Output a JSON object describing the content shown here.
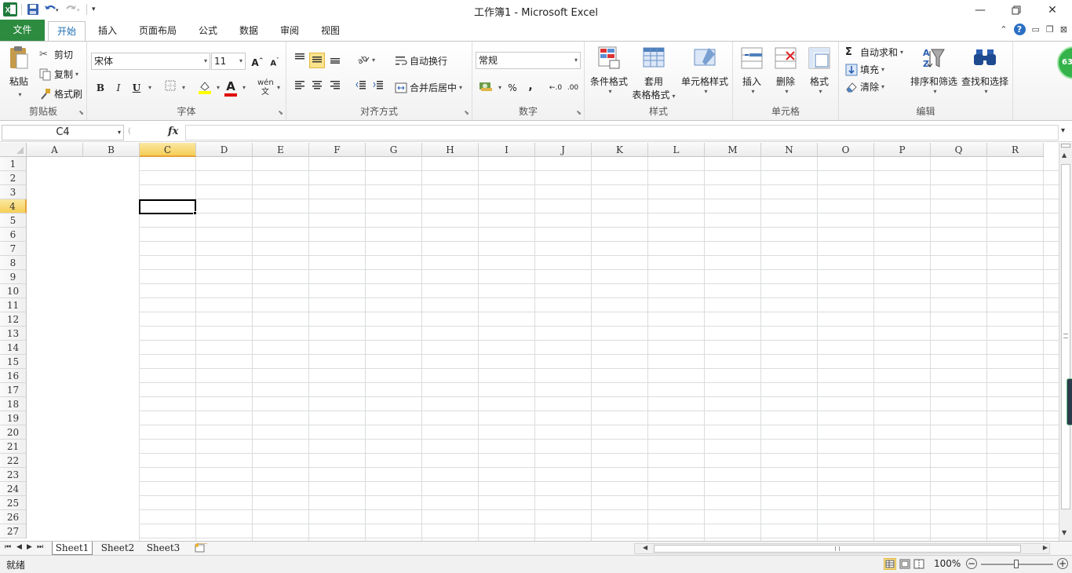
{
  "window": {
    "title": "工作簿1 - Microsoft Excel",
    "app_icon": "excel-icon",
    "quick_access": [
      "save-icon",
      "undo-icon",
      "redo-icon",
      "customize-icon"
    ],
    "controls": [
      "minimize-icon",
      "restore-icon",
      "close-icon"
    ]
  },
  "tabs": {
    "items": [
      "文件",
      "开始",
      "插入",
      "页面布局",
      "公式",
      "数据",
      "审阅",
      "视图"
    ],
    "active": "开始",
    "file_color": "#2c8b3f"
  },
  "ribbon": {
    "clipboard": {
      "paste": "粘贴",
      "cut": "剪切",
      "copy": "复制",
      "format_painter": "格式刷",
      "label": "剪贴板"
    },
    "font": {
      "font_name": "宋体",
      "font_size": "11",
      "bold": "B",
      "italic": "I",
      "underline": "U",
      "font_color_letter": "A",
      "label": "字体"
    },
    "alignment": {
      "wrap_text": "自动换行",
      "merge_center": "合并后居中",
      "label": "对齐方式"
    },
    "number": {
      "format": "常规",
      "percent": "%",
      "comma": ",",
      "label": "数字"
    },
    "styles": {
      "conditional": "条件格式",
      "table_format_1": "套用",
      "table_format_2": "表格格式",
      "cell_styles": "单元格样式",
      "label": "样式"
    },
    "cells": {
      "insert": "插入",
      "delete": "删除",
      "format": "格式",
      "label": "单元格"
    },
    "editing": {
      "autosum": "自动求和",
      "fill": "填充",
      "clear": "清除",
      "sort_filter": "排序和筛选",
      "find_select": "查找和选择",
      "label": "编辑"
    },
    "badge": "63"
  },
  "formula_bar": {
    "name_box": "C4",
    "fx": "fx",
    "value": ""
  },
  "grid": {
    "columns": [
      "A",
      "B",
      "C",
      "D",
      "E",
      "F",
      "G",
      "H",
      "I",
      "J",
      "K",
      "L",
      "M",
      "N",
      "O",
      "P",
      "Q",
      "R"
    ],
    "rows": [
      "1",
      "2",
      "3",
      "4",
      "5",
      "6",
      "7",
      "8",
      "9",
      "10",
      "11",
      "12",
      "13",
      "14",
      "15",
      "16",
      "17",
      "18",
      "19",
      "20",
      "21",
      "22",
      "23",
      "24",
      "25",
      "26",
      "27"
    ],
    "selected_column": "C",
    "selected_row": "4"
  },
  "sheets": {
    "tabs": [
      "Sheet1",
      "Sheet2",
      "Sheet3"
    ],
    "active": "Sheet1"
  },
  "status": {
    "text": "就绪",
    "zoom": "100%"
  },
  "colors": {
    "accent": "#2c8b3f",
    "selection": "#f5cf56"
  }
}
